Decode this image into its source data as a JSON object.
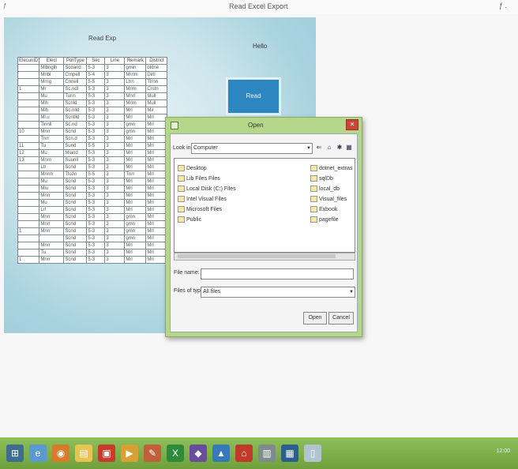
{
  "window": {
    "title": "Read Excel Export",
    "icon": "app-icon",
    "controls": "ƒ ."
  },
  "form": {
    "grid_label": "Read Exp",
    "hello_label": "Hello",
    "right_button": "Read",
    "grid": {
      "headers": [
        "ElecunID",
        "Elect",
        "PollType",
        "Sec",
        "Line",
        "Remark",
        "District"
      ],
      "rows": [
        [
          "",
          "Mlbnglh",
          "Scdand",
          "5-3",
          "3",
          "gmin",
          "bldne"
        ],
        [
          "",
          "Mnbl",
          "Crnpell",
          "5-4",
          "3",
          "Mrrlm",
          "Dirll"
        ],
        [
          "",
          "Mrng",
          "Cnnell",
          "5-5",
          "3",
          "Ltrn",
          "Tlrnn"
        ],
        [
          "1",
          "Mr",
          "Sc.ndl",
          "5-3",
          "3",
          "Mrlm",
          "Crstn"
        ],
        [
          "",
          "Mu",
          "Tunn",
          "5-3",
          "3",
          "Mnrl",
          "Mull"
        ],
        [
          "",
          "Mlh",
          "Scnld",
          "5-3",
          "3",
          "Mrlm",
          "Mull"
        ],
        [
          "",
          "Mlh",
          "Sc.nlld",
          "5-3",
          "3",
          "Mrl",
          "Mir"
        ],
        [
          "",
          "Ml.u",
          "Scntlld",
          "5-3",
          "3",
          "Mrl",
          "Mrl"
        ],
        [
          "",
          "Tinnll",
          "Sc.nd",
          "5-3",
          "3",
          "gmn",
          "Mrl"
        ],
        [
          "10",
          "Mnrr",
          "Scnd",
          "5-3",
          "3",
          "gmn",
          "Mrl"
        ],
        [
          "",
          "Tnrr",
          "Scn.d",
          "5-3",
          "3",
          "Mrl",
          "Mrl"
        ],
        [
          "11",
          "Tu",
          "Sund",
          "5-5",
          "3",
          "Mrl",
          "Mrl"
        ],
        [
          "12",
          "Mu",
          "Mland",
          "5-3",
          "3",
          "Mrl",
          "Mrl"
        ],
        [
          "13",
          "Mnrn",
          "Suunll",
          "5-3",
          "3",
          "Mrl",
          "Mrl"
        ],
        [
          "",
          "Ltr",
          "Scnd",
          "5-3",
          "3",
          "Mrl",
          "Mrl"
        ],
        [
          "",
          "Mnrrn",
          "Tlcdn",
          "5-5",
          "3",
          "Tnrr",
          "Mrl"
        ],
        [
          "",
          "Mu",
          "Scnd",
          "5-3",
          "3",
          "Mrl",
          "Mrl"
        ],
        [
          "",
          "Mlu",
          "Scnd",
          "5-3",
          "3",
          "Mrl",
          "Mrl"
        ],
        [
          "",
          "Mnrr",
          "Scnd",
          "5-3",
          "3",
          "Mrl",
          "Mrl"
        ],
        [
          "",
          "Mu",
          "Scnd",
          "5-3",
          "3",
          "Mrl",
          "Mrl"
        ],
        [
          "",
          "Lrl",
          "Scnd",
          "5-3",
          "3",
          "Mrl",
          "Mrl"
        ],
        [
          "",
          "Mnrr",
          "Scnd",
          "5-3",
          "3",
          "gmn",
          "Mrl"
        ],
        [
          "",
          "Mnrr",
          "Scnd",
          "5-3",
          "3",
          "gmn",
          "Mrl"
        ],
        [
          "1",
          "Mnrr",
          "Scnd",
          "5-3",
          "3",
          "gmn",
          "Mrl"
        ],
        [
          "",
          "",
          "Scnd",
          "5-3",
          "3",
          "gmn",
          "Mrl"
        ],
        [
          "",
          "Mnrr",
          "Scnd",
          "5-3",
          "3",
          "Mrl",
          "Mrl"
        ],
        [
          "",
          "Tu",
          "Scnd",
          "5-3",
          "3",
          "Mrl",
          "Mrl"
        ],
        [
          "1",
          "Mnrr",
          "Scnd",
          "5-3",
          "3",
          "Mrl",
          "Mrl"
        ]
      ]
    }
  },
  "dialog": {
    "title": "Open",
    "look_in_label": "Look in:",
    "look_in_value": "Computer",
    "tools": [
      "⇐",
      "⌂",
      "✱",
      "▦"
    ],
    "files_left": [
      "Desktop",
      "Lib Files Files",
      "Local Disk (C:) Files",
      "Intel Visual Files",
      "Microsoft Files",
      "Public"
    ],
    "files_right": [
      "dotnet_extras",
      "sqlDb",
      "local_db",
      "Visual_files",
      "Exbook",
      "pagefile"
    ],
    "file_name_label": "File name:",
    "file_name_value": "",
    "file_type_label": "Files of type:",
    "file_type_value": "All files",
    "open_button": "Open",
    "cancel_button": "Cancel"
  },
  "taskbar": {
    "items": [
      {
        "name": "start-icon",
        "glyph": "⊞",
        "color": "#3c6e92"
      },
      {
        "name": "ie-icon",
        "glyph": "e",
        "color": "#5a9ad0"
      },
      {
        "name": "firefox-icon",
        "glyph": "◉",
        "color": "#d77a2a"
      },
      {
        "name": "folder-icon",
        "glyph": "▤",
        "color": "#e7c352"
      },
      {
        "name": "pdf-icon",
        "glyph": "▣",
        "color": "#c93a2e"
      },
      {
        "name": "media-icon",
        "glyph": "▶",
        "color": "#d8a032"
      },
      {
        "name": "paint-icon",
        "glyph": "✎",
        "color": "#c0603a"
      },
      {
        "name": "excel-icon",
        "glyph": "X",
        "color": "#2e8b3c"
      },
      {
        "name": "visual-studio-icon",
        "glyph": "◆",
        "color": "#6a4c9c"
      },
      {
        "name": "app-icon",
        "glyph": "▲",
        "color": "#3579b8"
      },
      {
        "name": "home-icon",
        "glyph": "⌂",
        "color": "#c0392b"
      },
      {
        "name": "document-icon",
        "glyph": "▥",
        "color": "#7f8c8d"
      },
      {
        "name": "window-icon",
        "glyph": "▦",
        "color": "#2c5f8a"
      },
      {
        "name": "notepad-icon",
        "glyph": "▯",
        "color": "#b0c4cf"
      }
    ],
    "clock": "12:00"
  }
}
